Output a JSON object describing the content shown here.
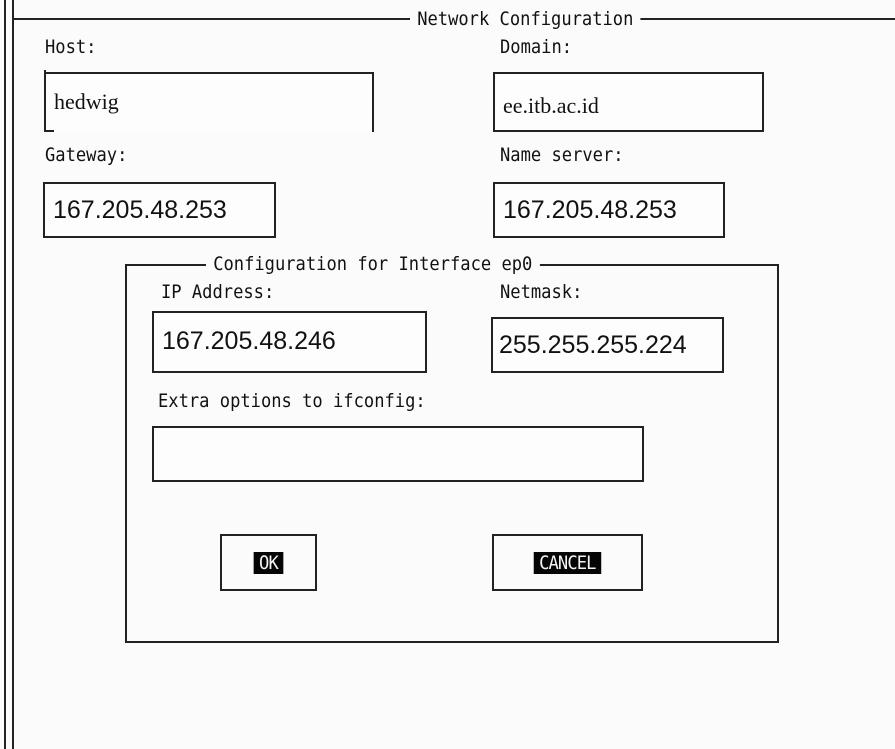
{
  "window": {
    "title": "Network Configuration"
  },
  "host": {
    "label": "Host:",
    "value": "hedwig"
  },
  "domain": {
    "label": "Domain:",
    "value": "ee.itb.ac.id"
  },
  "gateway": {
    "label": "Gateway:",
    "value": "167.205.48.253"
  },
  "nameserver": {
    "label": "Name server:",
    "value": "167.205.48.253"
  },
  "interface": {
    "title": "Configuration for Interface ep0",
    "ip": {
      "label": "IP Address:",
      "value": "167.205.48.246"
    },
    "netmask": {
      "label": "Netmask:",
      "value": "255.255.255.224"
    },
    "extra": {
      "label": "Extra options to ifconfig:",
      "value": ""
    }
  },
  "buttons": {
    "ok": "OK",
    "cancel": "CANCEL"
  }
}
